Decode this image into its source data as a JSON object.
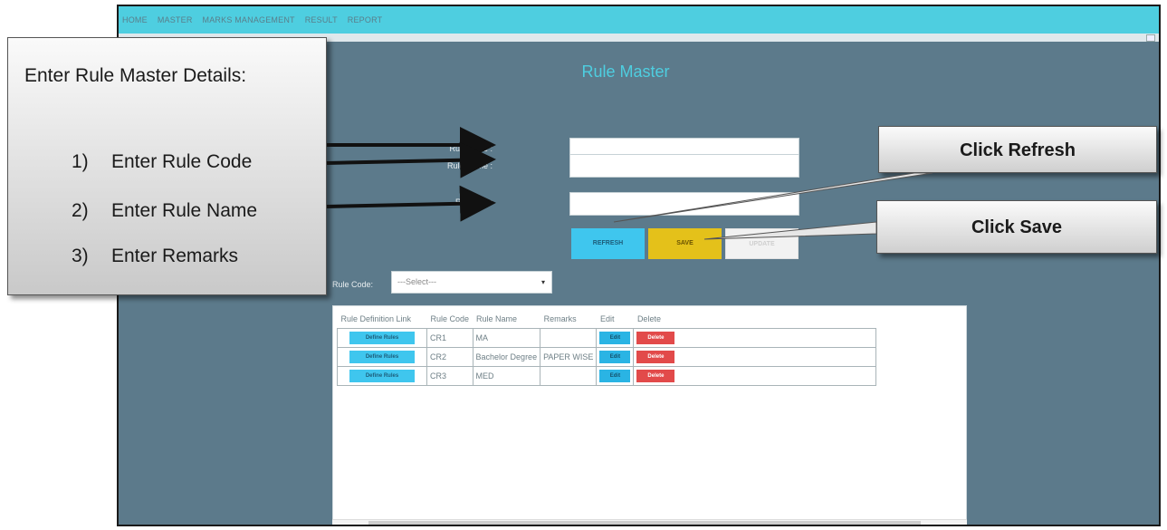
{
  "menu": [
    "HOME",
    "MASTER",
    "MARKS MANAGEMENT",
    "RESULT",
    "REPORT"
  ],
  "page_title": "Rule Master",
  "form": {
    "rule_code_label": "Rule Code :",
    "rule_name_label": "Rule Name :",
    "remarks_label": "Remarks :",
    "rule_code_value": "",
    "rule_name_value": "",
    "remarks_value": ""
  },
  "buttons": {
    "refresh": "REFRESH",
    "save": "SAVE",
    "update": "UPDATE"
  },
  "filter": {
    "label": "Rule Code:",
    "selected": "---Select---"
  },
  "grid": {
    "headers": [
      "Rule Definition Link",
      "Rule Code",
      "Rule Name",
      "Remarks",
      "Edit",
      "Delete"
    ],
    "rows": [
      {
        "define": "Define Rules",
        "code": "CR1",
        "name": "MA",
        "remarks": "",
        "edit": "Edit",
        "delete": "Delete"
      },
      {
        "define": "Define Rules",
        "code": "CR2",
        "name": "Bachelor Degree",
        "remarks": "PAPER WISE",
        "edit": "Edit",
        "delete": "Delete"
      },
      {
        "define": "Define Rules",
        "code": "CR3",
        "name": "MED",
        "remarks": "",
        "edit": "Edit",
        "delete": "Delete"
      }
    ]
  },
  "callout": {
    "heading": "Enter Rule Master Details:",
    "steps": [
      {
        "num": "1)",
        "text": "Enter Rule Code"
      },
      {
        "num": "2)",
        "text": "Enter Rule Name"
      },
      {
        "num": "3)",
        "text": "Enter Remarks"
      }
    ]
  },
  "tips": {
    "refresh": "Click Refresh",
    "save": "Click Save"
  }
}
